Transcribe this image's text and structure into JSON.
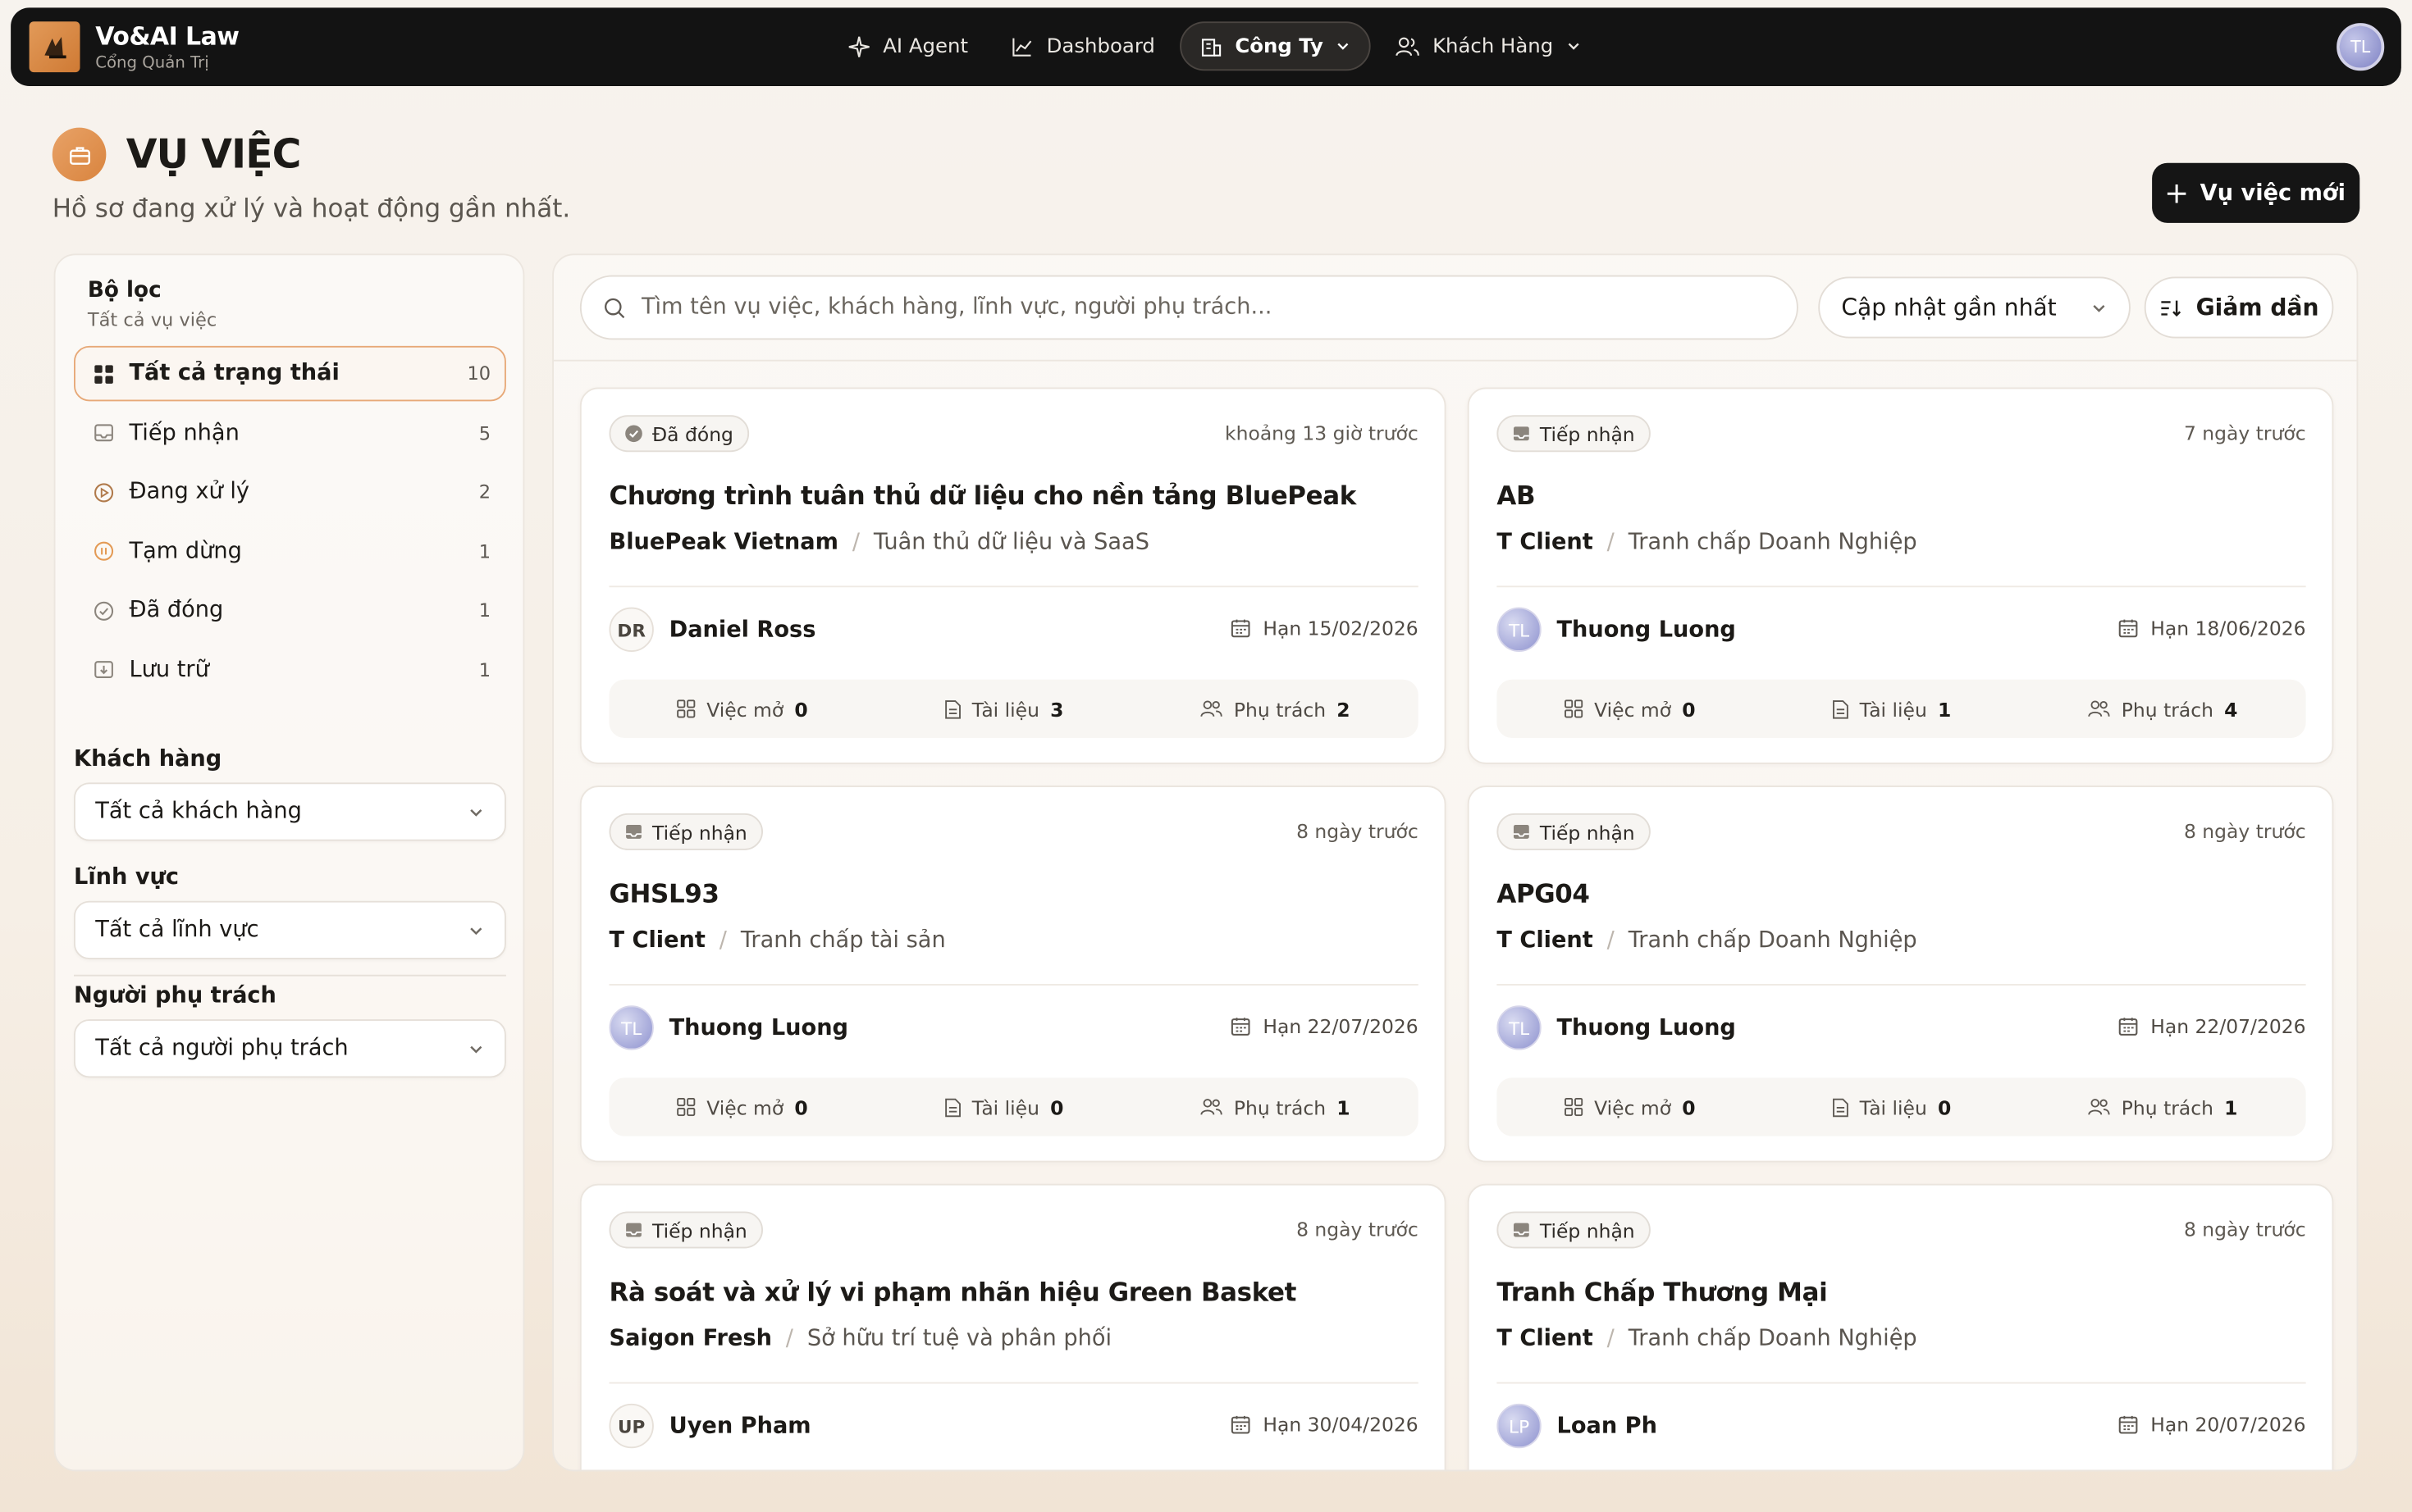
{
  "brand": {
    "name": "Vo&AI Law",
    "subtitle": "Cổng Quản Trị"
  },
  "nav": [
    {
      "label": "AI Agent",
      "icon": "sparkle-icon"
    },
    {
      "label": "Dashboard",
      "icon": "chart-line-icon"
    },
    {
      "label": "Công Ty",
      "icon": "building-icon",
      "active": true,
      "dropdown": true
    },
    {
      "label": "Khách Hàng",
      "icon": "users-icon",
      "dropdown": true
    }
  ],
  "user": {
    "initials": "TL"
  },
  "page": {
    "title": "VỤ VIỆC",
    "subtitle": "Hồ sơ đang xử lý và hoạt động gần nhất.",
    "new_button": "Vụ việc mới"
  },
  "sidebar": {
    "title": "Bộ lọc",
    "subtitle": "Tất cả vụ việc",
    "statuses": [
      {
        "label": "Tất cả trạng thái",
        "count": "10",
        "icon": "grid-icon",
        "active": true
      },
      {
        "label": "Tiếp nhận",
        "count": "5",
        "icon": "inbox-icon"
      },
      {
        "label": "Đang xử lý",
        "count": "2",
        "icon": "play-circle-icon"
      },
      {
        "label": "Tạm dừng",
        "count": "1",
        "icon": "pause-circle-icon"
      },
      {
        "label": "Đã đóng",
        "count": "1",
        "icon": "check-circle-icon"
      },
      {
        "label": "Lưu trữ",
        "count": "1",
        "icon": "archive-icon"
      }
    ],
    "filters": [
      {
        "label": "Khách hàng",
        "value": "Tất cả khách hàng"
      },
      {
        "label": "Lĩnh vực",
        "value": "Tất cả lĩnh vực"
      },
      {
        "label": "Người phụ trách",
        "value": "Tất cả người phụ trách"
      }
    ]
  },
  "toolbar": {
    "search_placeholder": "Tìm tên vụ việc, khách hàng, lĩnh vực, người phụ trách...",
    "sort": "Cập nhật gần nhất",
    "order": "Giảm dần"
  },
  "labels": {
    "open_tasks": "Việc mở",
    "documents": "Tài liệu",
    "assignees": "Phụ trách"
  },
  "cases": [
    {
      "status": "Đã đóng",
      "status_icon": "check-circle-icon",
      "time": "khoảng 13 giờ trước",
      "title": "Chương trình tuân thủ dữ liệu cho nền tảng BluePeak",
      "client": "BluePeak Vietnam",
      "field": "Tuân thủ dữ liệu và SaaS",
      "owner": "Daniel Ross",
      "owner_initials": "DR",
      "owner_photo": false,
      "due": "Hạn 15/02/2026",
      "open_tasks": "0",
      "documents": "3",
      "assignees": "2"
    },
    {
      "status": "Tiếp nhận",
      "status_icon": "inbox-icon",
      "time": "7 ngày trước",
      "title": "AB",
      "client": "T Client",
      "field": "Tranh chấp Doanh Nghiệp",
      "owner": "Thuong Luong",
      "owner_initials": "TL",
      "owner_photo": true,
      "due": "Hạn 18/06/2026",
      "open_tasks": "0",
      "documents": "1",
      "assignees": "4"
    },
    {
      "status": "Tiếp nhận",
      "status_icon": "inbox-icon",
      "time": "8 ngày trước",
      "title": "GHSL93",
      "client": "T Client",
      "field": "Tranh chấp tài sản",
      "owner": "Thuong Luong",
      "owner_initials": "TL",
      "owner_photo": true,
      "due": "Hạn 22/07/2026",
      "open_tasks": "0",
      "documents": "0",
      "assignees": "1"
    },
    {
      "status": "Tiếp nhận",
      "status_icon": "inbox-icon",
      "time": "8 ngày trước",
      "title": "APG04",
      "client": "T Client",
      "field": "Tranh chấp Doanh Nghiệp",
      "owner": "Thuong Luong",
      "owner_initials": "TL",
      "owner_photo": true,
      "due": "Hạn 22/07/2026",
      "open_tasks": "0",
      "documents": "0",
      "assignees": "1"
    },
    {
      "status": "Tiếp nhận",
      "status_icon": "inbox-icon",
      "time": "8 ngày trước",
      "title": "Rà soát và xử lý vi phạm nhãn hiệu Green Basket",
      "client": "Saigon Fresh",
      "field": "Sở hữu trí tuệ và phân phối",
      "owner": "Uyen Pham",
      "owner_initials": "UP",
      "owner_photo": false,
      "due": "Hạn 30/04/2026",
      "open_tasks": "",
      "documents": "",
      "assignees": ""
    },
    {
      "status": "Tiếp nhận",
      "status_icon": "inbox-icon",
      "time": "8 ngày trước",
      "title": "Tranh Chấp Thương Mại",
      "client": "T Client",
      "field": "Tranh chấp Doanh Nghiệp",
      "owner": "Loan Ph",
      "owner_initials": "LP",
      "owner_photo": true,
      "due": "Hạn 20/07/2026",
      "open_tasks": "",
      "documents": "",
      "assignees": ""
    }
  ],
  "colors": {
    "accent": "#e29a59",
    "topbar": "#131313",
    "active_border": "#e7a978"
  }
}
